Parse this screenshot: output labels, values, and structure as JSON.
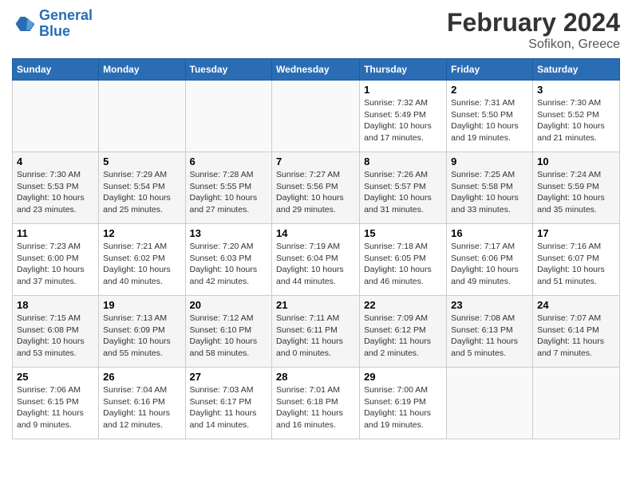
{
  "header": {
    "logo_line1": "General",
    "logo_line2": "Blue",
    "month": "February 2024",
    "location": "Sofikon, Greece"
  },
  "columns": [
    "Sunday",
    "Monday",
    "Tuesday",
    "Wednesday",
    "Thursday",
    "Friday",
    "Saturday"
  ],
  "weeks": [
    [
      {
        "day": "",
        "info": ""
      },
      {
        "day": "",
        "info": ""
      },
      {
        "day": "",
        "info": ""
      },
      {
        "day": "",
        "info": ""
      },
      {
        "day": "1",
        "info": "Sunrise: 7:32 AM\nSunset: 5:49 PM\nDaylight: 10 hours and 17 minutes."
      },
      {
        "day": "2",
        "info": "Sunrise: 7:31 AM\nSunset: 5:50 PM\nDaylight: 10 hours and 19 minutes."
      },
      {
        "day": "3",
        "info": "Sunrise: 7:30 AM\nSunset: 5:52 PM\nDaylight: 10 hours and 21 minutes."
      }
    ],
    [
      {
        "day": "4",
        "info": "Sunrise: 7:30 AM\nSunset: 5:53 PM\nDaylight: 10 hours and 23 minutes."
      },
      {
        "day": "5",
        "info": "Sunrise: 7:29 AM\nSunset: 5:54 PM\nDaylight: 10 hours and 25 minutes."
      },
      {
        "day": "6",
        "info": "Sunrise: 7:28 AM\nSunset: 5:55 PM\nDaylight: 10 hours and 27 minutes."
      },
      {
        "day": "7",
        "info": "Sunrise: 7:27 AM\nSunset: 5:56 PM\nDaylight: 10 hours and 29 minutes."
      },
      {
        "day": "8",
        "info": "Sunrise: 7:26 AM\nSunset: 5:57 PM\nDaylight: 10 hours and 31 minutes."
      },
      {
        "day": "9",
        "info": "Sunrise: 7:25 AM\nSunset: 5:58 PM\nDaylight: 10 hours and 33 minutes."
      },
      {
        "day": "10",
        "info": "Sunrise: 7:24 AM\nSunset: 5:59 PM\nDaylight: 10 hours and 35 minutes."
      }
    ],
    [
      {
        "day": "11",
        "info": "Sunrise: 7:23 AM\nSunset: 6:00 PM\nDaylight: 10 hours and 37 minutes."
      },
      {
        "day": "12",
        "info": "Sunrise: 7:21 AM\nSunset: 6:02 PM\nDaylight: 10 hours and 40 minutes."
      },
      {
        "day": "13",
        "info": "Sunrise: 7:20 AM\nSunset: 6:03 PM\nDaylight: 10 hours and 42 minutes."
      },
      {
        "day": "14",
        "info": "Sunrise: 7:19 AM\nSunset: 6:04 PM\nDaylight: 10 hours and 44 minutes."
      },
      {
        "day": "15",
        "info": "Sunrise: 7:18 AM\nSunset: 6:05 PM\nDaylight: 10 hours and 46 minutes."
      },
      {
        "day": "16",
        "info": "Sunrise: 7:17 AM\nSunset: 6:06 PM\nDaylight: 10 hours and 49 minutes."
      },
      {
        "day": "17",
        "info": "Sunrise: 7:16 AM\nSunset: 6:07 PM\nDaylight: 10 hours and 51 minutes."
      }
    ],
    [
      {
        "day": "18",
        "info": "Sunrise: 7:15 AM\nSunset: 6:08 PM\nDaylight: 10 hours and 53 minutes."
      },
      {
        "day": "19",
        "info": "Sunrise: 7:13 AM\nSunset: 6:09 PM\nDaylight: 10 hours and 55 minutes."
      },
      {
        "day": "20",
        "info": "Sunrise: 7:12 AM\nSunset: 6:10 PM\nDaylight: 10 hours and 58 minutes."
      },
      {
        "day": "21",
        "info": "Sunrise: 7:11 AM\nSunset: 6:11 PM\nDaylight: 11 hours and 0 minutes."
      },
      {
        "day": "22",
        "info": "Sunrise: 7:09 AM\nSunset: 6:12 PM\nDaylight: 11 hours and 2 minutes."
      },
      {
        "day": "23",
        "info": "Sunrise: 7:08 AM\nSunset: 6:13 PM\nDaylight: 11 hours and 5 minutes."
      },
      {
        "day": "24",
        "info": "Sunrise: 7:07 AM\nSunset: 6:14 PM\nDaylight: 11 hours and 7 minutes."
      }
    ],
    [
      {
        "day": "25",
        "info": "Sunrise: 7:06 AM\nSunset: 6:15 PM\nDaylight: 11 hours and 9 minutes."
      },
      {
        "day": "26",
        "info": "Sunrise: 7:04 AM\nSunset: 6:16 PM\nDaylight: 11 hours and 12 minutes."
      },
      {
        "day": "27",
        "info": "Sunrise: 7:03 AM\nSunset: 6:17 PM\nDaylight: 11 hours and 14 minutes."
      },
      {
        "day": "28",
        "info": "Sunrise: 7:01 AM\nSunset: 6:18 PM\nDaylight: 11 hours and 16 minutes."
      },
      {
        "day": "29",
        "info": "Sunrise: 7:00 AM\nSunset: 6:19 PM\nDaylight: 11 hours and 19 minutes."
      },
      {
        "day": "",
        "info": ""
      },
      {
        "day": "",
        "info": ""
      }
    ]
  ]
}
